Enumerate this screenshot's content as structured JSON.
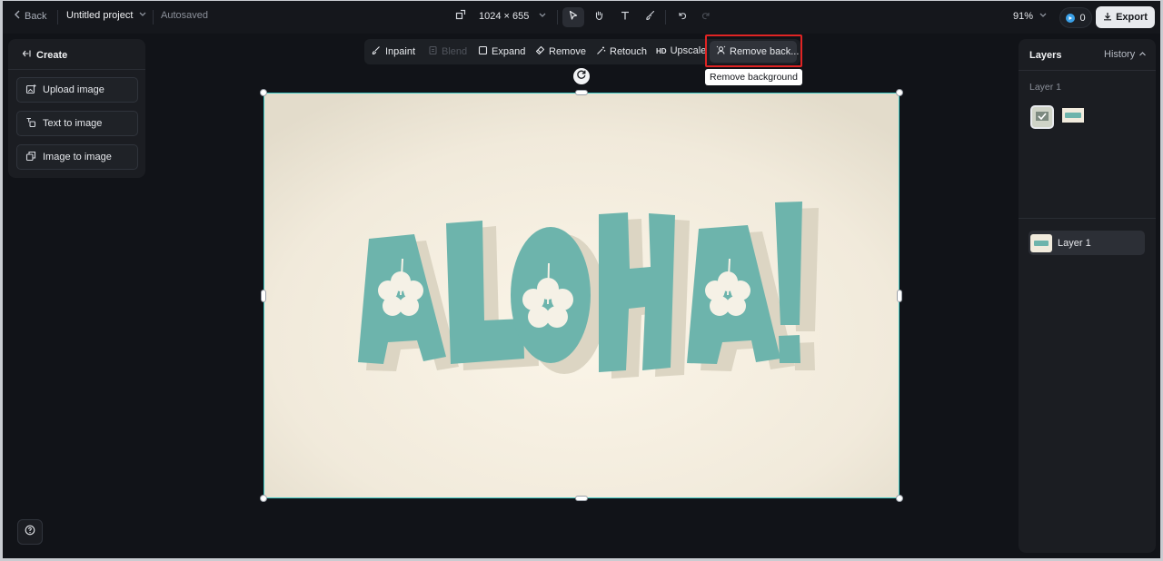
{
  "topbar": {
    "back_label": "Back",
    "project_name": "Untitled project",
    "autosave_status": "Autosaved",
    "canvas_size": "1024 × 655",
    "zoom": "91%",
    "credits": "0",
    "export_label": "Export"
  },
  "left_panel": {
    "title": "Create",
    "buttons": [
      {
        "label": "Upload image",
        "icon": "upload-image-icon"
      },
      {
        "label": "Text to image",
        "icon": "text-to-image-icon"
      },
      {
        "label": "Image to image",
        "icon": "image-to-image-icon"
      }
    ]
  },
  "edit_toolbar": {
    "items": [
      {
        "label": "Inpaint",
        "icon": "inpaint-icon",
        "enabled": true
      },
      {
        "label": "Blend",
        "icon": "blend-icon",
        "enabled": false
      },
      {
        "label": "Expand",
        "icon": "expand-icon",
        "enabled": true
      },
      {
        "label": "Remove",
        "icon": "eraser-icon",
        "enabled": true
      },
      {
        "label": "Retouch",
        "icon": "retouch-icon",
        "enabled": true
      },
      {
        "label": "Upscale",
        "icon": "hd-icon",
        "badge": "HD",
        "enabled": true
      },
      {
        "label": "Remove back...",
        "icon": "remove-background-icon",
        "enabled": true,
        "active": true
      }
    ],
    "tooltip": "Remove background"
  },
  "canvas": {
    "image_text": "ALOHA!",
    "colors": {
      "letters": "#6cb5ad",
      "shadow": "#d9d3c3",
      "background": "#f3ecdc",
      "selection": "#3ec8c4"
    }
  },
  "right_panel": {
    "title": "Layers",
    "history_label": "History",
    "layer_group_label": "Layer 1",
    "layer_row_label": "Layer 1"
  }
}
